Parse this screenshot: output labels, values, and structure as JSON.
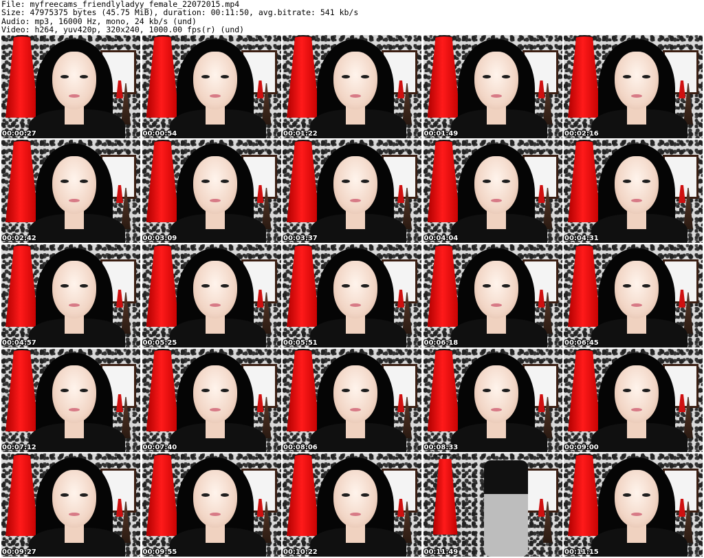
{
  "header": {
    "file": "File: myfreecams_friendlyladyy_female_22072015.mp4",
    "size": "Size: 47975375 bytes (45.75 MiB), duration: 00:11:50, avg.bitrate: 541 kb/s",
    "audio": "Audio: mp3, 16000 Hz, mono, 24 kb/s (und)",
    "video": "Video: h264, yuv420p, 320x240, 1000.00 fps(r) (und)"
  },
  "thumbnails": [
    {
      "time": "00:00:27"
    },
    {
      "time": "00:00:54"
    },
    {
      "time": "00:01:22"
    },
    {
      "time": "00:01:49"
    },
    {
      "time": "00:02:16"
    },
    {
      "time": "00:02:42"
    },
    {
      "time": "00:03:09"
    },
    {
      "time": "00:03:37"
    },
    {
      "time": "00:04:04"
    },
    {
      "time": "00:04:31"
    },
    {
      "time": "00:04:57"
    },
    {
      "time": "00:05:25"
    },
    {
      "time": "00:05:51"
    },
    {
      "time": "00:06:18"
    },
    {
      "time": "00:06:45"
    },
    {
      "time": "00:07:12"
    },
    {
      "time": "00:07:40"
    },
    {
      "time": "00:08:06"
    },
    {
      "time": "00:08:33"
    },
    {
      "time": "00:09:00"
    },
    {
      "time": "00:09:27"
    },
    {
      "time": "00:09:55"
    },
    {
      "time": "00:10:22"
    },
    {
      "time": "00:11:49"
    },
    {
      "time": "00:11:15"
    }
  ]
}
